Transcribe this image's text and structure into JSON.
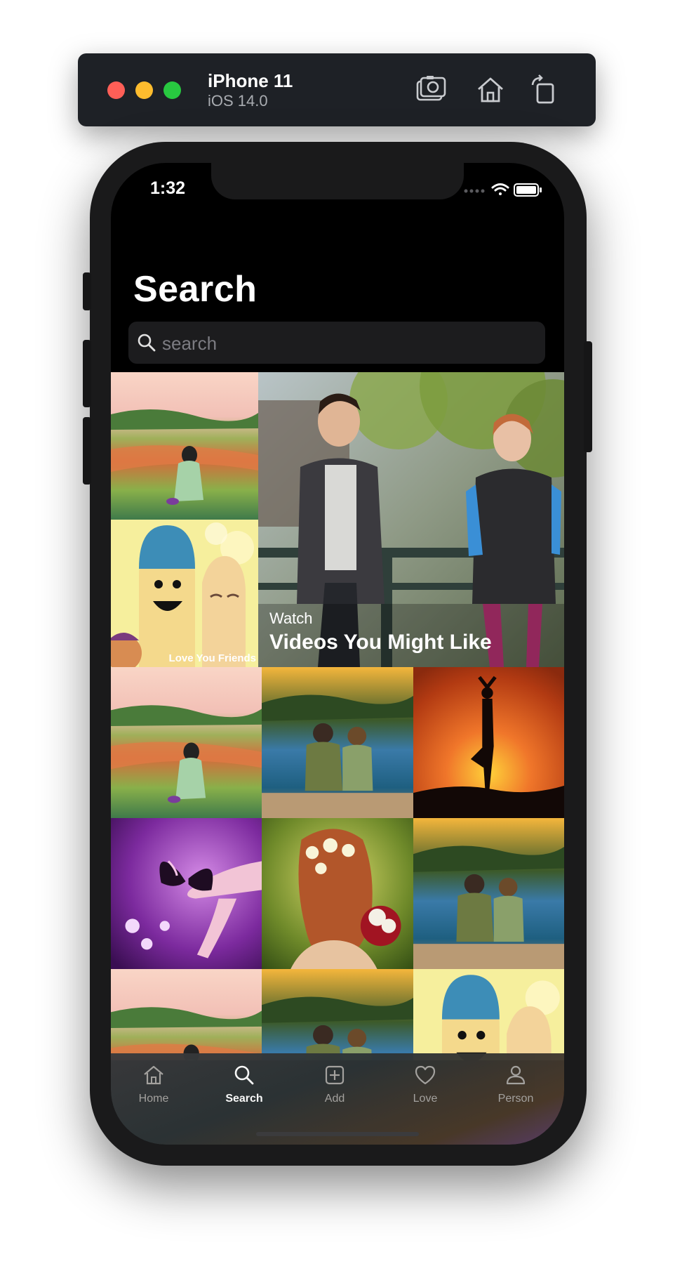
{
  "simulator": {
    "device_name": "iPhone 11",
    "os_version": "iOS 14.0"
  },
  "status_bar": {
    "time": "1:32"
  },
  "page": {
    "title": "Search"
  },
  "search": {
    "placeholder": "search"
  },
  "featured": {
    "kicker": "Watch",
    "headline": "Videos You Might Like"
  },
  "tiles": [
    {
      "icon": "landscape-girl-photo"
    },
    {
      "icon": "smiley-fingers-photo",
      "overlay_text": "Love You Friends"
    },
    {
      "icon": "landscape-girl-photo"
    },
    {
      "icon": "kids-by-lake-photo"
    },
    {
      "icon": "yoga-sunset-photo"
    },
    {
      "icon": "butterfly-hand-photo"
    },
    {
      "icon": "flower-hair-photo"
    },
    {
      "icon": "kids-by-lake-photo"
    },
    {
      "icon": "landscape-girl-photo"
    },
    {
      "icon": "kids-by-lake-photo"
    },
    {
      "icon": "smiley-fingers-photo"
    }
  ],
  "tabbar": {
    "items": [
      {
        "label": "Home",
        "icon": "home-icon",
        "active": false
      },
      {
        "label": "Search",
        "icon": "search-icon",
        "active": true
      },
      {
        "label": "Add",
        "icon": "add-icon",
        "active": false
      },
      {
        "label": "Love",
        "icon": "heart-icon",
        "active": false
      },
      {
        "label": "Person",
        "icon": "person-icon",
        "active": false
      }
    ]
  }
}
